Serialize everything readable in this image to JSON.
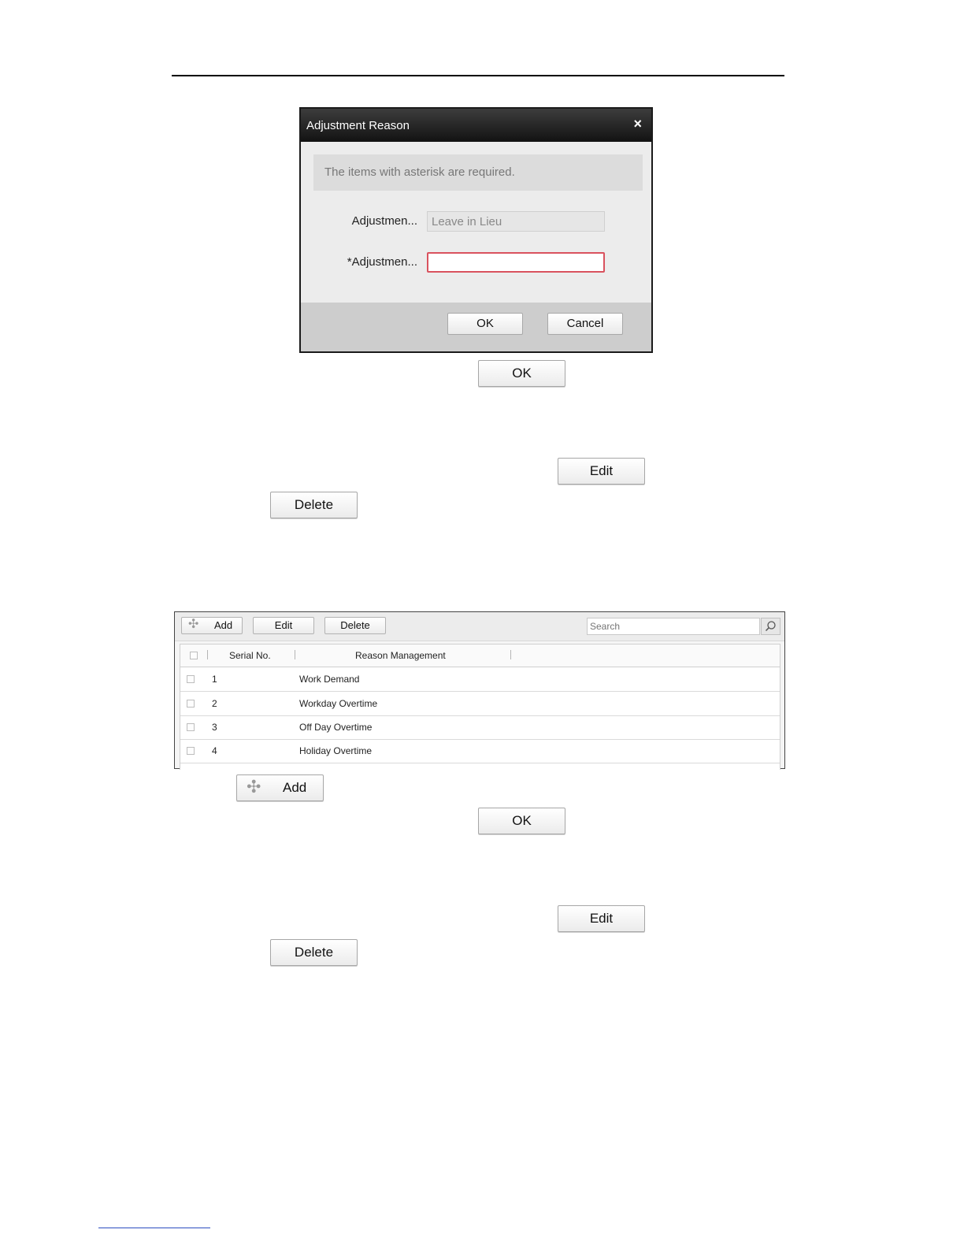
{
  "dialog": {
    "title": "Adjustment Reason",
    "close_glyph": "×",
    "notice": "The items with asterisk are required.",
    "field1_label": "Adjustmen...",
    "field1_value": "Leave in Lieu",
    "field2_label": "*Adjustmen...",
    "field2_value": "",
    "ok": "OK",
    "cancel": "Cancel"
  },
  "buttons": {
    "ok": "OK",
    "edit": "Edit",
    "delete": "Delete",
    "add": "Add",
    "plus_glyph": "✣"
  },
  "table": {
    "toolbar": {
      "add": "Add",
      "edit": "Edit",
      "delete": "Delete",
      "search_placeholder": "Search"
    },
    "columns": [
      "Serial No.",
      "Reason Management"
    ],
    "rows": [
      {
        "serial": "1",
        "reason": "Work Demand"
      },
      {
        "serial": "2",
        "reason": "Workday Overtime"
      },
      {
        "serial": "3",
        "reason": "Off Day Overtime"
      },
      {
        "serial": "4",
        "reason": "Holiday Overtime"
      }
    ]
  }
}
